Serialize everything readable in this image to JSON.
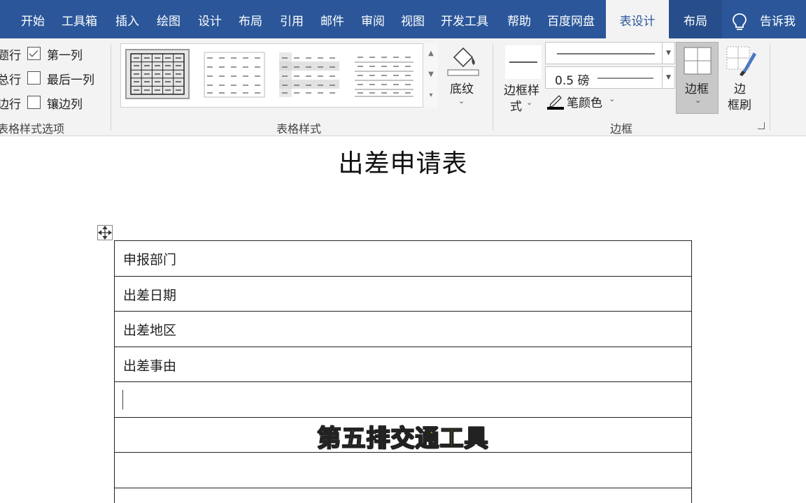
{
  "tabs": [
    {
      "label": "开始"
    },
    {
      "label": "工具箱"
    },
    {
      "label": "插入"
    },
    {
      "label": "绘图"
    },
    {
      "label": "设计"
    },
    {
      "label": "布局"
    },
    {
      "label": "引用"
    },
    {
      "label": "邮件"
    },
    {
      "label": "审阅"
    },
    {
      "label": "视图"
    },
    {
      "label": "开发工具"
    },
    {
      "label": "帮助"
    },
    {
      "label": "百度网盘"
    },
    {
      "label": "表设计"
    },
    {
      "label": "布局"
    }
  ],
  "active_tab": "表设计",
  "tell_me": "告诉我",
  "table_style_options": {
    "items": [
      {
        "label": "题行",
        "checked": null
      },
      {
        "label": "总行",
        "checked": null
      },
      {
        "label": "边行",
        "checked": null
      },
      {
        "label": "第一列",
        "checked": true
      },
      {
        "label": "最后一列",
        "checked": false
      },
      {
        "label": "镶边列",
        "checked": false
      }
    ],
    "group_label": "表格样式选项"
  },
  "table_styles": {
    "group_label": "表格样式",
    "shading_label": "底纹"
  },
  "borders": {
    "border_styles_label_1": "边框样",
    "border_styles_label_2": "式",
    "pen_weight": "0.5 磅",
    "pen_color_label": "笔颜色",
    "borders_label": "边框",
    "painter_label_1": "边",
    "painter_label_2": "框刷",
    "group_label": "边框"
  },
  "document": {
    "title": "出差申请表",
    "rows": [
      "申报部门",
      "出差日期",
      "出差地区",
      "出差事由",
      "",
      "",
      "",
      ""
    ]
  },
  "subtitle": "第五排交通工具",
  "colors": {
    "tab_bar": "#2b579a",
    "ribbon": "#f3f3f3",
    "subtitle_fill": "#ffe600"
  }
}
